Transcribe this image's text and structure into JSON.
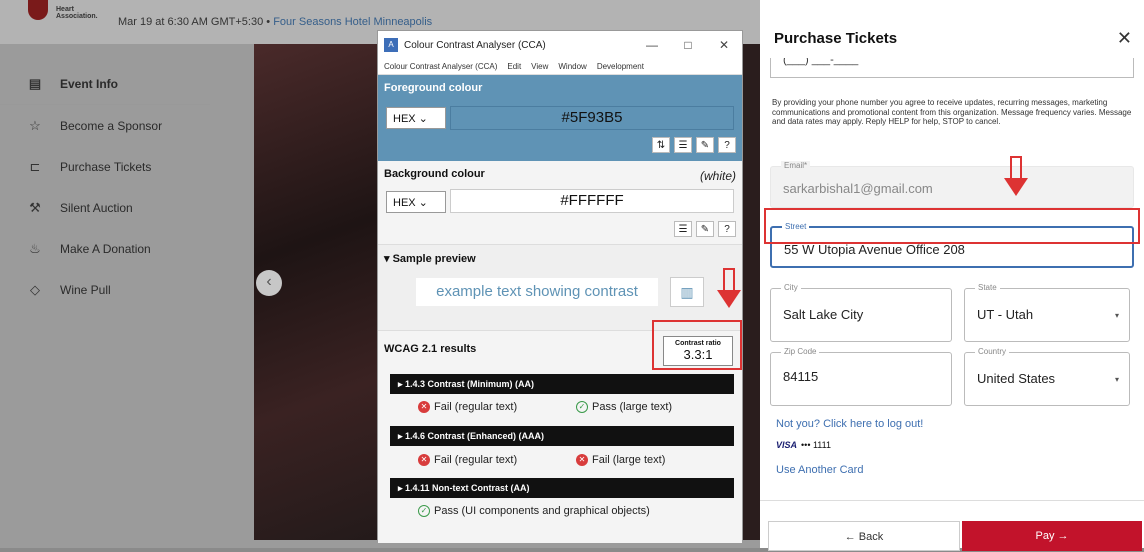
{
  "background": {
    "logo_text": "Heart Association.",
    "event_datetime": "Mar 19 at 6:30 AM GMT+5:30",
    "event_sep": "•",
    "event_venue": "Four Seasons Hotel Minneapolis",
    "prev_arrow": "‹",
    "sidebar": [
      {
        "label": "Event Info",
        "icon": "calendar-icon",
        "glyph": "▤"
      },
      {
        "label": "Become a Sponsor",
        "icon": "star-icon",
        "glyph": "☆"
      },
      {
        "label": "Purchase Tickets",
        "icon": "ticket-icon",
        "glyph": "⊏"
      },
      {
        "label": "Silent Auction",
        "icon": "gavel-icon",
        "glyph": "⚒"
      },
      {
        "label": "Make A Donation",
        "icon": "donation-icon",
        "glyph": "♨"
      },
      {
        "label": "Wine Pull",
        "icon": "tag-icon",
        "glyph": "◇"
      }
    ]
  },
  "cca": {
    "title": "Colour Contrast Analyser (CCA)",
    "app_icon": "A",
    "window_buttons": [
      "—",
      "□",
      "✕"
    ],
    "menu": [
      "Colour Contrast Analyser (CCA)",
      "Edit",
      "View",
      "Window",
      "Development"
    ],
    "foreground": {
      "label": "Foreground colour",
      "format": "HEX ⌄",
      "hex": "#5F93B5",
      "tools": [
        "⇅",
        "☰",
        "✎",
        "?"
      ]
    },
    "background": {
      "label": "Background colour",
      "name": "(white)",
      "format": "HEX ⌄",
      "hex": "#FFFFFF",
      "tools": [
        "☰",
        "✎",
        "?"
      ]
    },
    "sample": {
      "label": "▾ Sample preview",
      "text": "example text showing contrast",
      "chart_glyph": "▥"
    },
    "wcag": {
      "label": "WCAG 2.1 results",
      "ratio_label": "Contrast ratio",
      "ratio_value": "3.3:1",
      "criteria": [
        {
          "title": "▸ 1.4.3 Contrast (Minimum) (AA)",
          "r1": "Fail (regular text)",
          "r1_status": "fail",
          "r2": "Pass (large text)",
          "r2_status": "pass"
        },
        {
          "title": "▸ 1.4.6 Contrast (Enhanced) (AAA)",
          "r1": "Fail (regular text)",
          "r1_status": "fail",
          "r2": "Fail (large text)",
          "r2_status": "fail"
        },
        {
          "title": "▸ 1.4.11 Non-text Contrast (AA)",
          "r1": "Pass (UI components and graphical objects)",
          "r1_status": "pass"
        }
      ],
      "fail_glyph": "✕",
      "pass_glyph": "✓"
    }
  },
  "panel": {
    "title": "Purchase Tickets",
    "close": "✕",
    "phone_partial": "(___) ___-____",
    "consent": "By providing your phone number you agree to receive updates, recurring messages, marketing communications and promotional content from this organization. Message frequency varies. Message and data rates may apply. Reply HELP for help, STOP to cancel.",
    "email": {
      "label": "Email*",
      "value": "sarkarbishal1@gmail.com"
    },
    "street": {
      "label": "Street",
      "value": "55 W Utopia Avenue Office 208"
    },
    "city": {
      "label": "City",
      "value": "Salt Lake City"
    },
    "state": {
      "label": "State",
      "value": "UT - Utah"
    },
    "zip": {
      "label": "Zip Code",
      "value": "84115"
    },
    "country": {
      "label": "Country",
      "value": "United States"
    },
    "caret": "▾",
    "logout_link": "Not you? Click here to log out!",
    "card_brand": "VISA",
    "card_last": "••• 1111",
    "another_card": "Use Another Card",
    "back": "← Back",
    "pay": "Pay →"
  },
  "colors": {
    "foreground": "#5F93B5",
    "background": "#FFFFFF",
    "annotation_red": "#DD3333",
    "pay_button": "#C2132B"
  }
}
